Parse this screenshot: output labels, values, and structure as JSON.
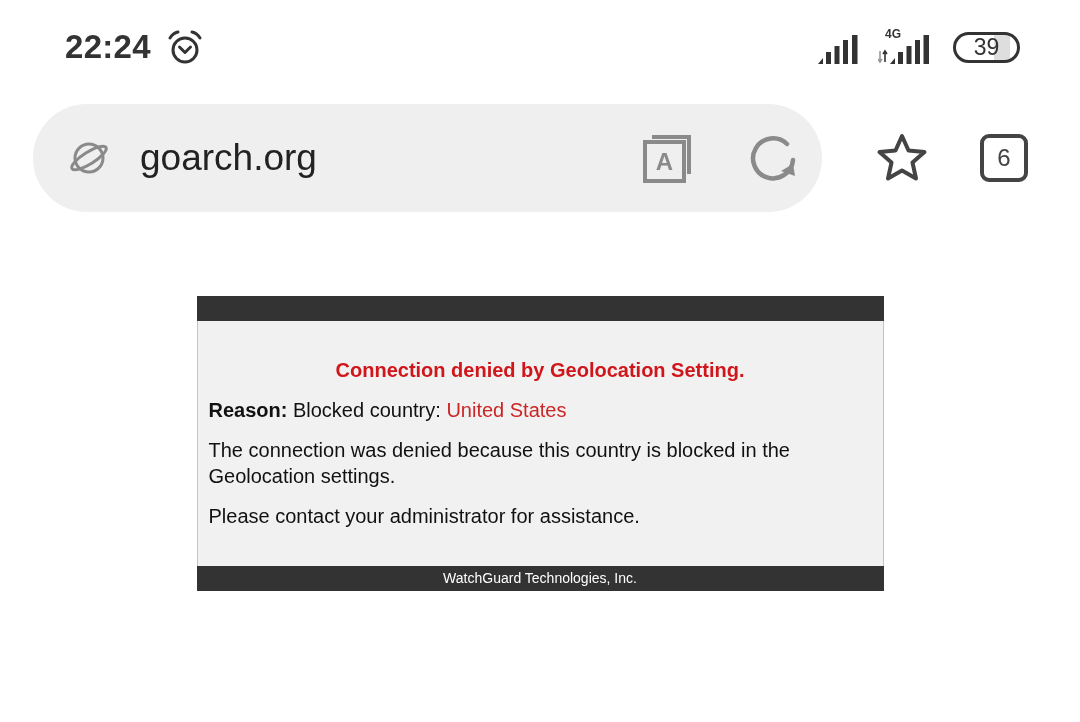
{
  "status_bar": {
    "time": "22:24",
    "network_type": "4G",
    "battery": "39"
  },
  "address_bar": {
    "url": "goarch.org",
    "reader_mode_letter": "A"
  },
  "toolbar": {
    "tab_count": "6"
  },
  "error_page": {
    "title": "Connection denied by Geolocation Setting.",
    "reason": "**Reason:** Blocked country:",
    "country": "United States",
    "paragraphs": [
      "The connection was denied because this country is blocked in the Geolocation settings.",
      "Please contact your administrator for assistance."
    ],
    "footer": "WatchGuard Technologies, Inc."
  }
}
